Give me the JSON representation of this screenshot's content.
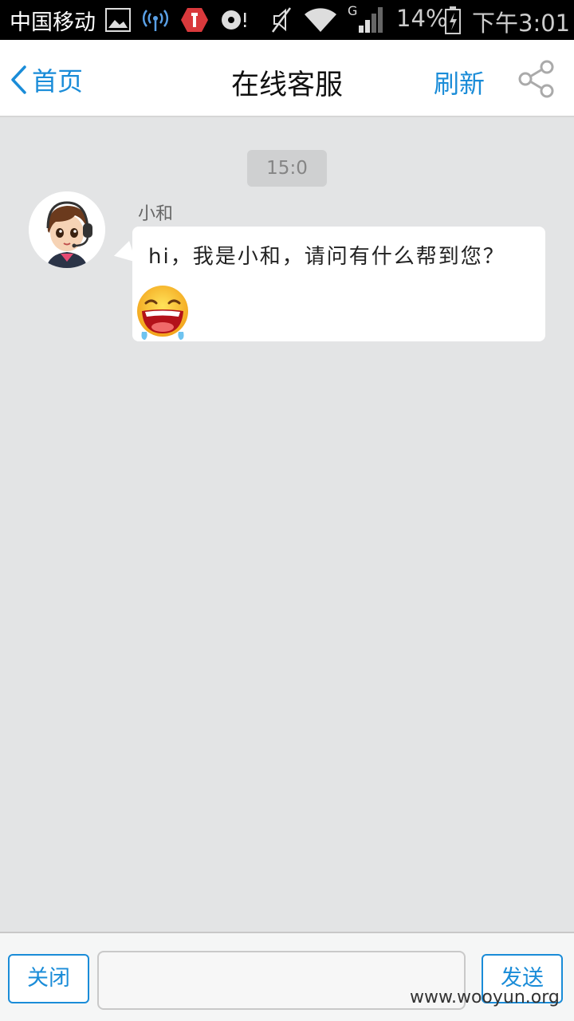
{
  "status_bar": {
    "carrier": "中国移动",
    "network_type": "G",
    "battery": "14%",
    "time": "下午3:01",
    "icons": [
      "gallery-icon",
      "signal-broadcast-icon",
      "shield-app-icon",
      "media-icon",
      "mute-icon",
      "wifi-icon",
      "cell-signal-icon",
      "battery-icon"
    ]
  },
  "header": {
    "back_label": "首页",
    "title": "在线客服",
    "refresh_label": "刷新",
    "share_icon": "share-icon",
    "accent_color": "#1a8cd8"
  },
  "chat": {
    "time": "15:0",
    "messages": [
      {
        "sender": "小和",
        "text": "hi，我是小和，请问有什么帮到您？",
        "emoji": "laughing-emoji-icon",
        "avatar": "agent-avatar"
      }
    ]
  },
  "bottom_bar": {
    "close_label": "关闭",
    "input_value": "",
    "send_label": "发送"
  },
  "watermark": "www.wooyun.org"
}
